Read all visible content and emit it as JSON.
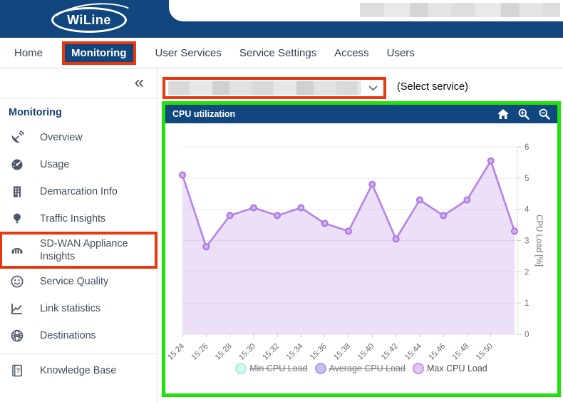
{
  "header": {
    "logo_text": "WiLine"
  },
  "nav": {
    "items": [
      {
        "label": "Home",
        "selected": false
      },
      {
        "label": "Monitoring",
        "selected": true,
        "annotated": true
      },
      {
        "label": "User Services",
        "selected": false
      },
      {
        "label": "Service Settings",
        "selected": false
      },
      {
        "label": "Access",
        "selected": false
      },
      {
        "label": "Users",
        "selected": false
      }
    ]
  },
  "sidebar": {
    "collapse_icon": "«",
    "section_title": "Monitoring",
    "items": [
      {
        "label": "Overview",
        "icon": "satellite-icon"
      },
      {
        "label": "Usage",
        "icon": "gauge-icon"
      },
      {
        "label": "Demarcation Info",
        "icon": "building-icon"
      },
      {
        "label": "Traffic Insights",
        "icon": "lightbulb-icon"
      },
      {
        "label": "SD-WAN Appliance Insights",
        "icon": "router-icon",
        "highlighted": true
      },
      {
        "label": "Service Quality",
        "icon": "smiley-icon"
      },
      {
        "label": "Link statistics",
        "icon": "line-chart-icon"
      },
      {
        "label": "Destinations",
        "icon": "globe-icon"
      },
      {
        "label": "Knowledge Base",
        "icon": "book-icon",
        "divider_before": true
      }
    ]
  },
  "main": {
    "service_select": {
      "value_redacted": true,
      "hint_label": "(Select service)"
    },
    "panel": {
      "title": "CPU utilization",
      "toolbar_icons": [
        "home-icon",
        "zoom-in-icon",
        "zoom-out-icon"
      ]
    }
  },
  "chart_data": {
    "type": "area",
    "title": "CPU utilization",
    "x_labels": [
      "15:24",
      "15:26",
      "15:28",
      "15:30",
      "15:32",
      "15:34",
      "15:36",
      "15:38",
      "15:40",
      "15:42",
      "15:44",
      "15:46",
      "15:48",
      "15:50",
      ""
    ],
    "series": [
      {
        "name": "Min CPU Load",
        "visible": false,
        "values": []
      },
      {
        "name": "Average CPU Load",
        "visible": false,
        "values": []
      },
      {
        "name": "Max CPU Load",
        "visible": true,
        "values": [
          5.1,
          2.8,
          3.8,
          4.05,
          3.8,
          4.05,
          3.55,
          3.3,
          4.8,
          3.05,
          4.3,
          3.8,
          4.3,
          5.55,
          3.3
        ]
      }
    ],
    "ylabel": "CPU Load [%]",
    "ylim": [
      0,
      6
    ],
    "yticks": [
      0,
      1,
      2,
      3,
      4,
      5,
      6
    ],
    "grid": true,
    "legend_position": "bottom",
    "legend": [
      {
        "label": "Min CPU Load",
        "struck": true,
        "fill": "#d3f6f1",
        "stroke": "#aeeae0"
      },
      {
        "label": "Average CPU Load",
        "struck": true,
        "fill": "#c8bff0",
        "stroke": "#a99de8"
      },
      {
        "label": "Max CPU Load",
        "struck": false,
        "fill": "#e3c8f6",
        "stroke": "#c590ee"
      }
    ]
  },
  "colors": {
    "brand_blue": "#11477e",
    "annotation_red": "#e8380f",
    "annotation_green": "#1fe20b",
    "line_purple": "#b583e8",
    "marker_fill": "#d2aff2",
    "marker_stroke": "#a873e2",
    "area_fill": "rgba(181,131,232,0.25)",
    "grid_gray": "#e8e8e8",
    "axis_text": "#6e6e6e"
  }
}
